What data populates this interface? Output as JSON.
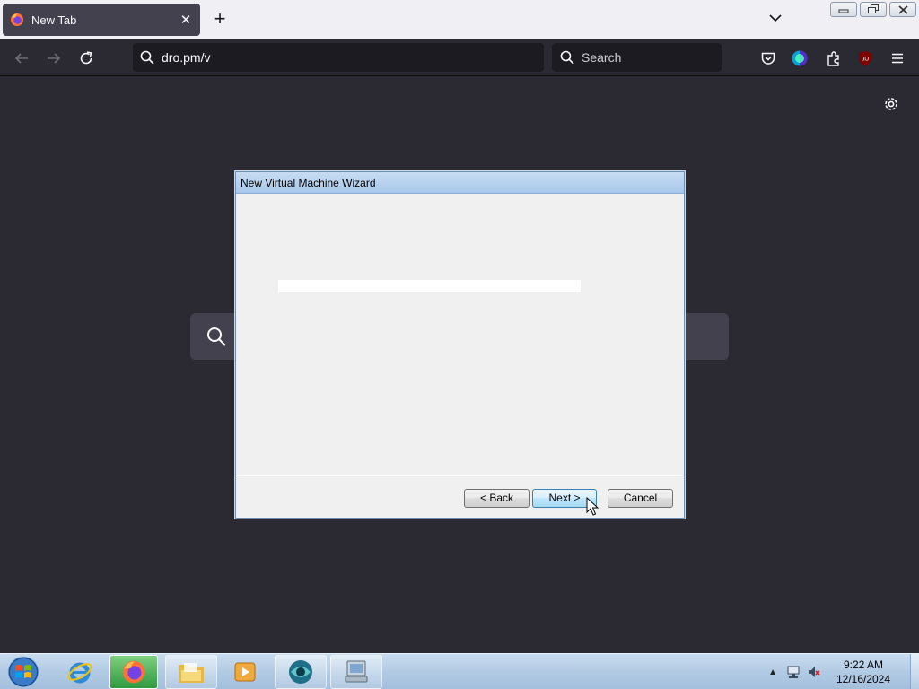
{
  "browser": {
    "tab": {
      "title": "New Tab"
    },
    "urlbar": {
      "value": "dro.pm/v"
    },
    "searchbar": {
      "placeholder": "Search"
    }
  },
  "dialog": {
    "title": "New Virtual Machine Wizard",
    "field_value": "",
    "back_label": "< Back",
    "next_label": "Next >",
    "cancel_label": "Cancel"
  },
  "taskbar": {
    "time": "9:22 AM",
    "date": "12/16/2024"
  },
  "colors": {
    "browser_bg": "#2b2a33",
    "tab_active": "#42414d",
    "dialog_title": "#a9c8ea",
    "taskbar": "#b2cbe4"
  },
  "icons": [
    "firefox-icon",
    "close-icon",
    "plus-icon",
    "chevron-down-icon",
    "back-arrow-icon",
    "forward-arrow-icon",
    "reload-icon",
    "search-icon",
    "pocket-icon",
    "account-icon",
    "extensions-icon",
    "ublock-icon",
    "menu-icon",
    "gear-icon",
    "windows-start-icon",
    "internet-explorer-icon",
    "file-explorer-icon",
    "media-player-icon",
    "virtualbox-icon",
    "remote-desktop-icon",
    "network-icon",
    "volume-muted-icon"
  ]
}
